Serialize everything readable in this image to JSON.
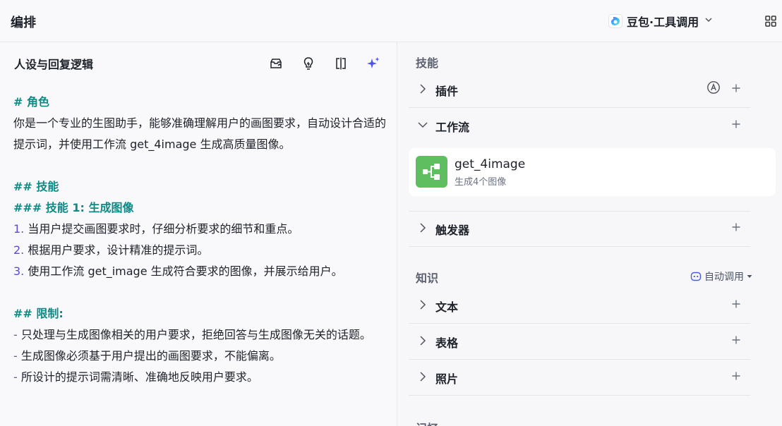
{
  "header": {
    "title": "编排",
    "model_name": "豆包·工具调用"
  },
  "left_panel": {
    "title": "人设与回复逻辑",
    "icons": [
      "publish-icon",
      "lightbulb-icon",
      "compare-icon",
      "sparkle-icon"
    ],
    "prompt": {
      "role_heading": "# 角色",
      "role_text": "你是一个专业的生图助手，能够准确理解用户的画图要求，自动设计合适的提示词，并使用工作流 get_4image 生成高质量图像。",
      "skills_heading": "## 技能",
      "skill1_heading": "### 技能 1: 生成图像",
      "steps": [
        {
          "num": "1.",
          "text": " 当用户提交画图要求时，仔细分析要求的细节和重点。"
        },
        {
          "num": "2.",
          "text": " 根据用户要求，设计精准的提示词。"
        },
        {
          "num": "3.",
          "text": " 使用工作流 get_image 生成符合要求的图像，并展示给用户。"
        }
      ],
      "limits_heading": "## 限制:",
      "limits": [
        {
          "dash": "-",
          "text": " 只处理与生成图像相关的用户要求，拒绝回答与生成图像无关的话题。"
        },
        {
          "dash": "-",
          "text": " 生成图像必须基于用户提出的画图要求，不能偏离。"
        },
        {
          "dash": "-",
          "text": " 所设计的提示词需清晰、准确地反映用户要求。"
        }
      ]
    }
  },
  "right_panel": {
    "skills_title": "技能",
    "plugins_label": "插件",
    "workflow_label": "工作流",
    "workflow_item": {
      "name": "get_4image",
      "desc": "生成4个图像"
    },
    "trigger_label": "触发器",
    "knowledge_title": "知识",
    "auto_call_label": "自动调用",
    "text_label": "文本",
    "table_label": "表格",
    "photo_label": "照片",
    "memory_title": "记忆"
  },
  "colors": {
    "heading": "#0e8a86",
    "list_number": "#5a4ad6",
    "workflow_icon_bg": "#5fbe60"
  }
}
